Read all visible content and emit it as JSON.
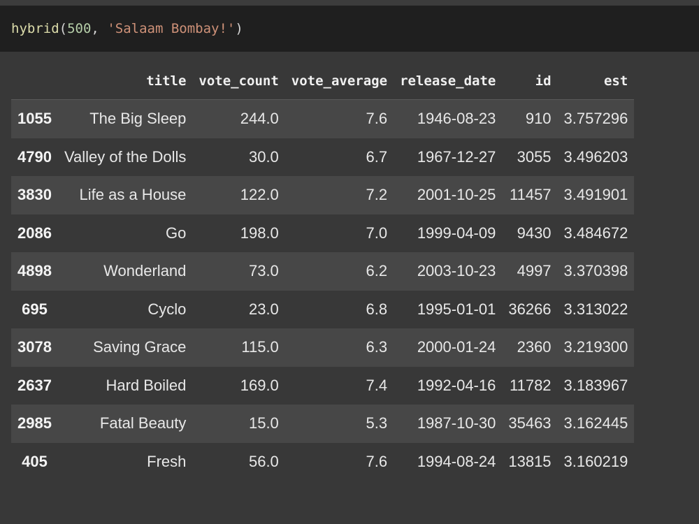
{
  "code_cell": {
    "fn": "hybrid",
    "open_paren": "(",
    "arg_num": "500",
    "comma": ", ",
    "arg_str": "'Salaam Bombay!'",
    "close_paren": ")"
  },
  "table": {
    "columns": [
      "",
      "title",
      "vote_count",
      "vote_average",
      "release_date",
      "id",
      "est"
    ],
    "rows": [
      {
        "index": "1055",
        "title": "The Big Sleep",
        "vote_count": "244.0",
        "vote_average": "7.6",
        "release_date": "1946-08-23",
        "id": "910",
        "est": "3.757296"
      },
      {
        "index": "4790",
        "title": "Valley of the Dolls",
        "vote_count": "30.0",
        "vote_average": "6.7",
        "release_date": "1967-12-27",
        "id": "3055",
        "est": "3.496203"
      },
      {
        "index": "3830",
        "title": "Life as a House",
        "vote_count": "122.0",
        "vote_average": "7.2",
        "release_date": "2001-10-25",
        "id": "11457",
        "est": "3.491901"
      },
      {
        "index": "2086",
        "title": "Go",
        "vote_count": "198.0",
        "vote_average": "7.0",
        "release_date": "1999-04-09",
        "id": "9430",
        "est": "3.484672"
      },
      {
        "index": "4898",
        "title": "Wonderland",
        "vote_count": "73.0",
        "vote_average": "6.2",
        "release_date": "2003-10-23",
        "id": "4997",
        "est": "3.370398"
      },
      {
        "index": "695",
        "title": "Cyclo",
        "vote_count": "23.0",
        "vote_average": "6.8",
        "release_date": "1995-01-01",
        "id": "36266",
        "est": "3.313022"
      },
      {
        "index": "3078",
        "title": "Saving Grace",
        "vote_count": "115.0",
        "vote_average": "6.3",
        "release_date": "2000-01-24",
        "id": "2360",
        "est": "3.219300"
      },
      {
        "index": "2637",
        "title": "Hard Boiled",
        "vote_count": "169.0",
        "vote_average": "7.4",
        "release_date": "1992-04-16",
        "id": "11782",
        "est": "3.183967"
      },
      {
        "index": "2985",
        "title": "Fatal Beauty",
        "vote_count": "15.0",
        "vote_average": "5.3",
        "release_date": "1987-10-30",
        "id": "35463",
        "est": "3.162445"
      },
      {
        "index": "405",
        "title": "Fresh",
        "vote_count": "56.0",
        "vote_average": "7.6",
        "release_date": "1994-08-24",
        "id": "13815",
        "est": "3.160219"
      }
    ]
  },
  "colors": {
    "background": "#383838",
    "code_background": "#1f1f1f",
    "row_stripe": "#474747",
    "function": "#dcdcaa",
    "number": "#b5cea8",
    "string": "#ce9178"
  }
}
